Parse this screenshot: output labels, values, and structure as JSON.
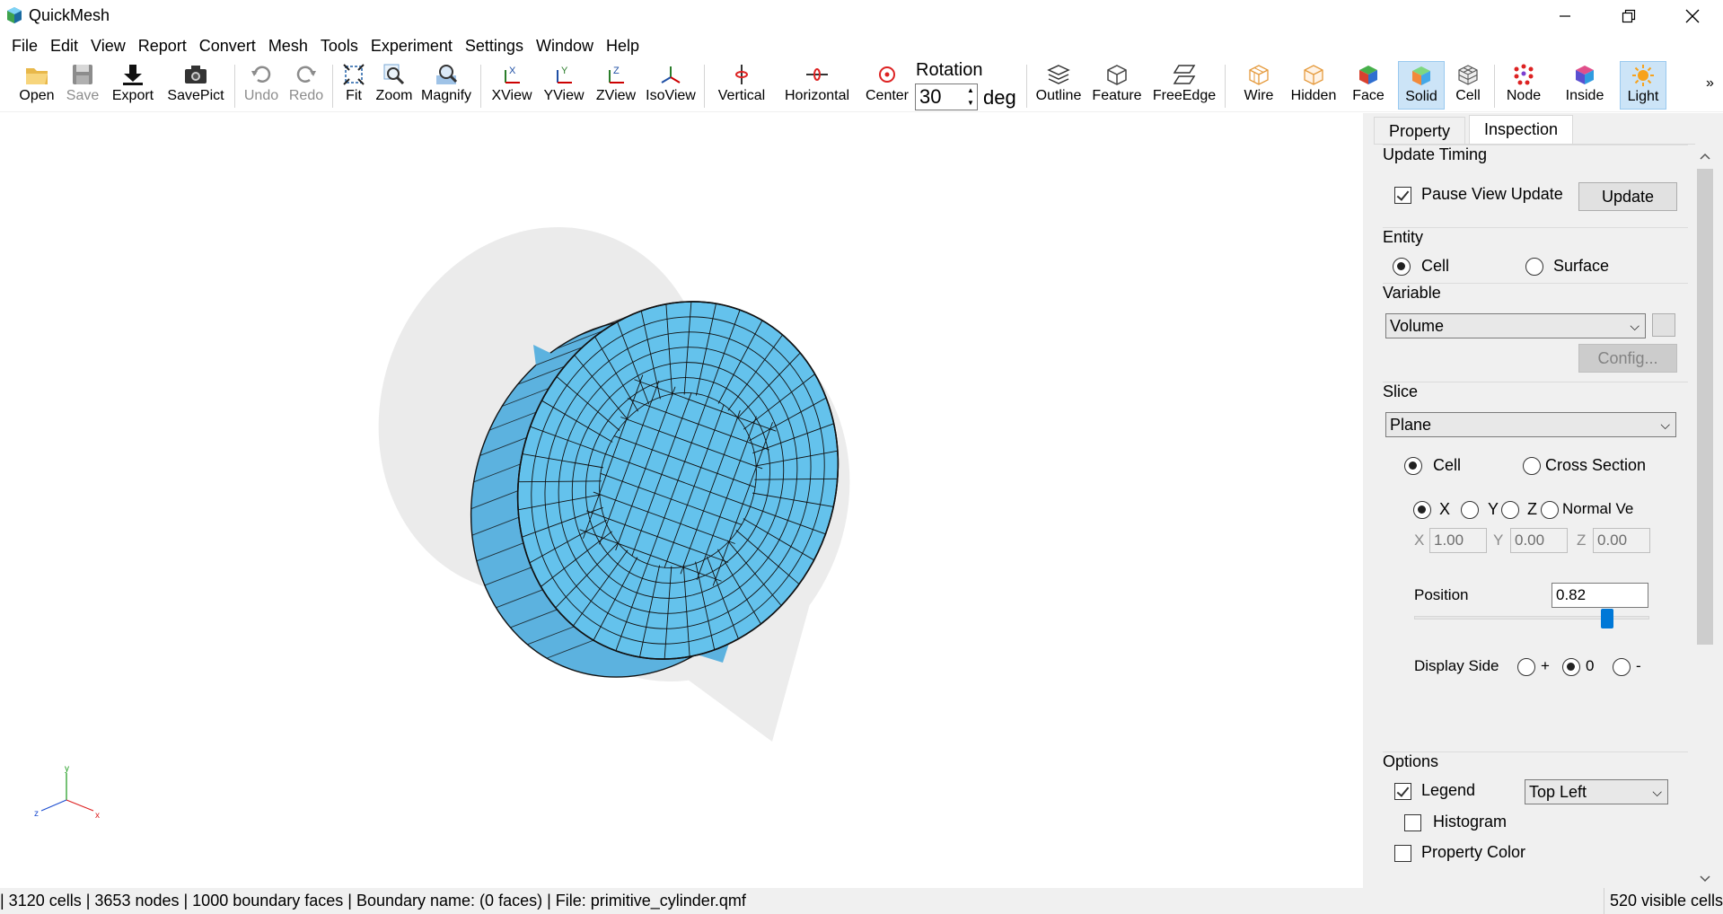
{
  "app": {
    "title": "QuickMesh"
  },
  "menu": [
    "File",
    "Edit",
    "View",
    "Report",
    "Convert",
    "Mesh",
    "Tools",
    "Experiment",
    "Settings",
    "Window",
    "Help"
  ],
  "toolbar": {
    "open": "Open",
    "save": "Save",
    "export": "Export",
    "savepict": "SavePict",
    "undo": "Undo",
    "redo": "Redo",
    "fit": "Fit",
    "zoom": "Zoom",
    "magnify": "Magnify",
    "xview": "XView",
    "yview": "YView",
    "zview": "ZView",
    "isoview": "IsoView",
    "vertical": "Vertical",
    "horizontal": "Horizontal",
    "center": "Center",
    "rotation_label": "Rotation",
    "rotation_value": "30",
    "rotation_unit": "deg",
    "outline": "Outline",
    "feature": "Feature",
    "freeedge": "FreeEdge",
    "wire": "Wire",
    "hidden": "Hidden",
    "face": "Face",
    "solid": "Solid",
    "cell": "Cell",
    "node": "Node",
    "inside": "Inside",
    "light": "Light",
    "more": "»"
  },
  "panel": {
    "tabs": [
      "Property",
      "Inspection"
    ],
    "active_tab": "Inspection",
    "update_timing": {
      "title": "Update Timing",
      "pause_label": "Pause View Update",
      "pause_checked": true,
      "update_button": "Update"
    },
    "entity": {
      "title": "Entity",
      "cell": "Cell",
      "surface": "Surface",
      "selected": "Cell"
    },
    "variable": {
      "title": "Variable",
      "value": "Volume",
      "config_button": "Config..."
    },
    "slice": {
      "title": "Slice",
      "mode": "Plane",
      "cell": "Cell",
      "cross_section": "Cross Section",
      "selected": "Cell",
      "axes": {
        "x": "X",
        "y": "Y",
        "z": "Z",
        "normal": "Normal Ve",
        "selected": "X"
      },
      "vec": {
        "x_label": "X",
        "x_value": "1.00",
        "y_label": "Y",
        "y_value": "0.00",
        "z_label": "Z",
        "z_value": "0.00"
      },
      "position_label": "Position",
      "position_value": "0.82",
      "position_fraction": 0.82,
      "display_side_label": "Display Side",
      "plus": "+",
      "zero": "0",
      "minus": "-",
      "display_side_selected": "0"
    },
    "options": {
      "title": "Options",
      "legend_label": "Legend",
      "legend_checked": true,
      "legend_position": "Top Left",
      "histogram_label": "Histogram",
      "histogram_checked": false,
      "property_color_label": "Property Color"
    }
  },
  "axes_triad": {
    "y": "y",
    "z": "z",
    "x": "x"
  },
  "status": {
    "left": "| 3120 cells | 3653 nodes | 1000 boundary faces |  Boundary name:  (0 faces) | File: primitive_cylinder.qmf",
    "right": "520 visible cells"
  },
  "colors": {
    "mesh_fill": "#62c0ea",
    "ghost_fill": "#ececec",
    "active_button": "#cce4f7",
    "slider_thumb": "#0078d7"
  }
}
